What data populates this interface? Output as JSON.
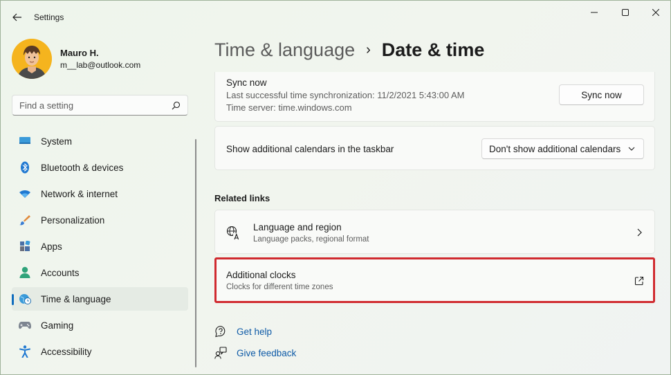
{
  "window": {
    "app_title": "Settings",
    "controls": [
      "minimize",
      "maximize",
      "close"
    ]
  },
  "profile": {
    "name": "Mauro H.",
    "email": "m__lab@outlook.com"
  },
  "search": {
    "placeholder": "Find a setting"
  },
  "sidebar": {
    "items": [
      {
        "label": "System",
        "icon": "monitor-icon"
      },
      {
        "label": "Bluetooth & devices",
        "icon": "bluetooth-icon"
      },
      {
        "label": "Network & internet",
        "icon": "wifi-icon"
      },
      {
        "label": "Personalization",
        "icon": "brush-icon"
      },
      {
        "label": "Apps",
        "icon": "apps-icon"
      },
      {
        "label": "Accounts",
        "icon": "person-icon"
      },
      {
        "label": "Time & language",
        "icon": "globe-clock-icon",
        "selected": true
      },
      {
        "label": "Gaming",
        "icon": "gamepad-icon"
      },
      {
        "label": "Accessibility",
        "icon": "accessibility-icon"
      }
    ]
  },
  "breadcrumb": {
    "parent": "Time & language",
    "separator": "›",
    "current": "Date & time"
  },
  "sync": {
    "title": "Sync now",
    "last_sync": "Last successful time synchronization: 11/2/2021 5:43:00 AM",
    "server": "Time server: time.windows.com",
    "button_label": "Sync now"
  },
  "calendars": {
    "label": "Show additional calendars in the taskbar",
    "selected_value": "Don't show additional calendars"
  },
  "related_links": {
    "title": "Related links",
    "items": [
      {
        "title": "Language and region",
        "subtitle": "Language packs, regional format",
        "action": "chevron-right-icon"
      },
      {
        "title": "Additional clocks",
        "subtitle": "Clocks for different time zones",
        "action": "external-link-icon",
        "highlighted": true
      }
    ]
  },
  "help": {
    "get_help": "Get help",
    "give_feedback": "Give feedback"
  },
  "colors": {
    "accent": "#0f6cbd",
    "highlight_border": "#d02a2f",
    "link": "#0e5aa7"
  }
}
